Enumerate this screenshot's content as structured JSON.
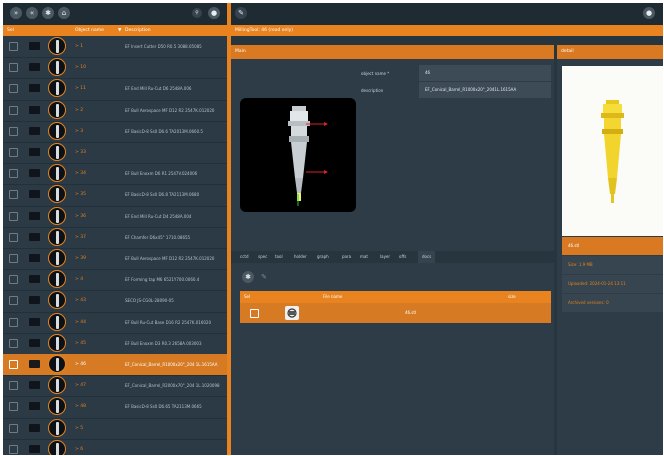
{
  "left": {
    "columns": {
      "sel": "Sel",
      "object_name": "Object name",
      "description": "Description"
    },
    "rows": [
      {
        "num": "> 1",
        "desc": "EF Insert Cutter D50 R0.5 3088.05085"
      },
      {
        "num": "> 10",
        "desc": ""
      },
      {
        "num": "> 11",
        "desc": "EF End Mill Ru-Cut D6 2548A.006"
      },
      {
        "num": "> 2",
        "desc": "EF Bull Aerospace MF D12 R2 2547K.012020"
      },
      {
        "num": "> 3",
        "desc": "EF BasicD-8 Ss0 D6.6 TA2013M.0660.5"
      },
      {
        "num": "> 33",
        "desc": ""
      },
      {
        "num": "> 34",
        "desc": "EF Bull Enoxm D6 R1 2547V.024006"
      },
      {
        "num": "> 35",
        "desc": "EF BasicD-8 Ss0 D6.8 TA2113M.0680"
      },
      {
        "num": "> 36",
        "desc": "EF End Mill Ru-Cut D4 2548A.004"
      },
      {
        "num": "> 37",
        "desc": "EF Chamfer D6x45° 1710.08655"
      },
      {
        "num": "> 39",
        "desc": "EF Bull Aerospace MF D12 R2 2547K.012020"
      },
      {
        "num": "> 4",
        "desc": "EF Forming tap M6 6521Y700.0060.4"
      },
      {
        "num": "> 43",
        "desc": "SECO JS-CG0L-28090-05"
      },
      {
        "num": "> 44",
        "desc": "EF Bull Ru-Cut Base D16 R2 2547K.016020"
      },
      {
        "num": "> 45",
        "desc": "EF Bull Enoxm D3 R0.3 2658A.003003"
      },
      {
        "num": "> 46",
        "desc": "EF_Conical_Barrel_R1000x20°_204 1L.1615AA"
      },
      {
        "num": "> 47",
        "desc": "EF_Conical_Barrel_R2000x70°_204 1L.1020098"
      },
      {
        "num": "> 48",
        "desc": "EF BasicD-8 Ss0 D6.65 TA2113M.0665"
      },
      {
        "num": "> 5",
        "desc": ""
      },
      {
        "num": "> 6",
        "desc": ""
      }
    ]
  },
  "right": {
    "title": "MillingTool: 46 (read only)",
    "main_header": "Main",
    "detail_header": "detail",
    "object_name_label": "object name *",
    "object_name_value": "46",
    "description_label": "description",
    "description_value": "EF_Conical_Barrel_R1000x20°_2041L.1615AA",
    "tabs": [
      "cctd",
      "spec",
      "tool",
      "holder",
      "graph",
      "para",
      "mat",
      "layer",
      "offs",
      "docs"
    ],
    "docs": {
      "col_sel": "Sel",
      "col_filename": "File name",
      "col_size": "size",
      "row_filename": "46.stl"
    },
    "detail_fields": [
      "46.stl",
      "Size: 1.9 MB",
      "Uploaded: 2024-01-24 13:11",
      "Archived versions: 0"
    ]
  },
  "icons": {
    "tool_left": [
      "expand-down-icon",
      "expand-up-icon",
      "settings-icon",
      "home-icon"
    ],
    "accent": "#e8831f"
  }
}
